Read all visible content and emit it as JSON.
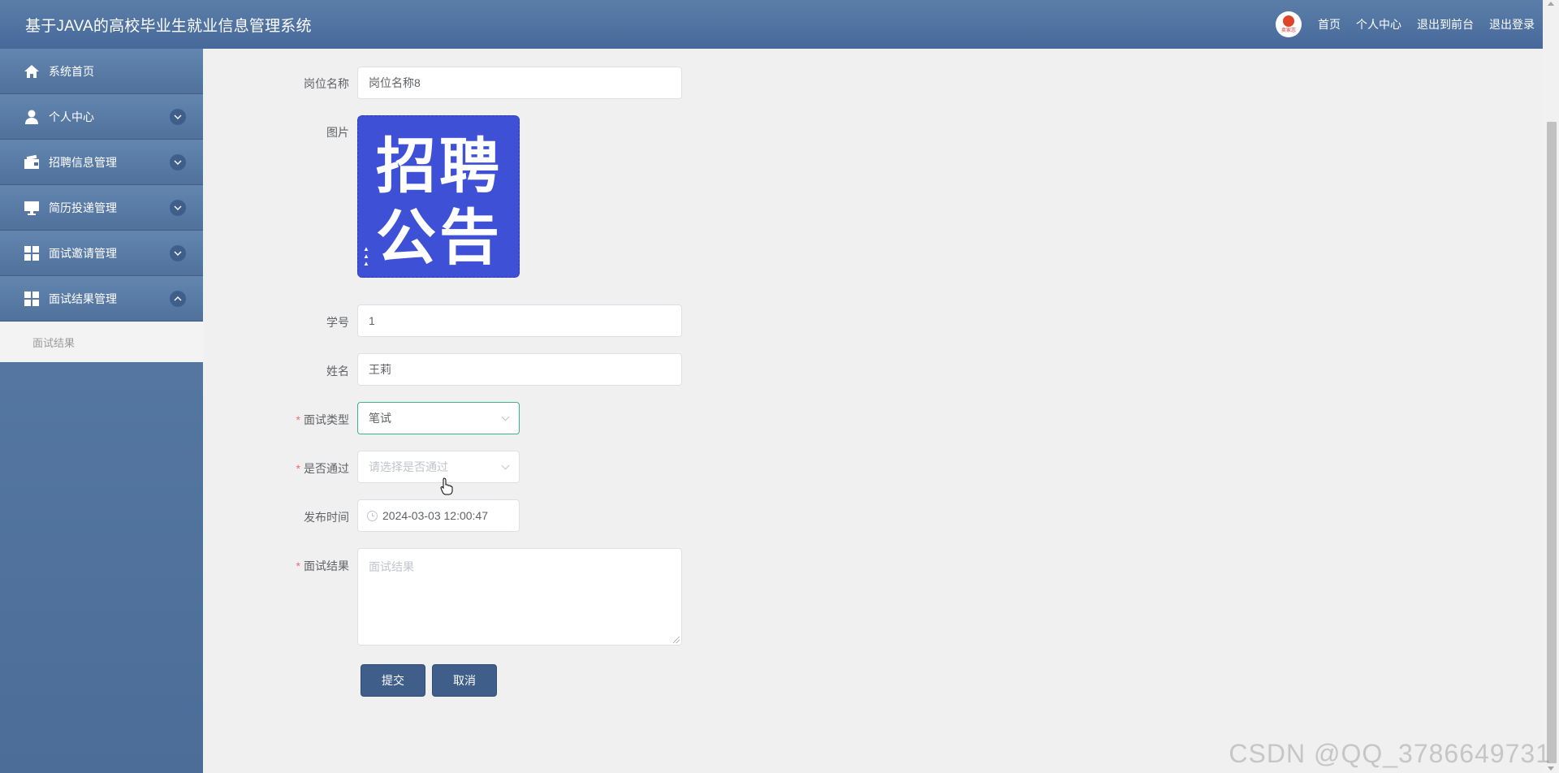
{
  "header": {
    "title": "基于JAVA的高校毕业生就业信息管理系统",
    "avatar_text": "卖家志",
    "nav": [
      "首页",
      "个人中心",
      "退出到前台",
      "退出登录"
    ]
  },
  "sidebar": {
    "items": [
      {
        "label": "系统首页",
        "icon": "home-icon"
      },
      {
        "label": "个人中心",
        "icon": "user-icon"
      },
      {
        "label": "招聘信息管理",
        "icon": "wallet-icon"
      },
      {
        "label": "简历投递管理",
        "icon": "monitor-icon"
      },
      {
        "label": "面试邀请管理",
        "icon": "grid-icon"
      },
      {
        "label": "面试结果管理",
        "icon": "grid-icon"
      }
    ],
    "submenu": {
      "label": "面试结果"
    }
  },
  "form": {
    "job_name": {
      "label": "岗位名称",
      "value": "岗位名称8"
    },
    "image": {
      "label": "图片",
      "poster_text_line1": "招聘",
      "poster_text_line2": "公告"
    },
    "student_id": {
      "label": "学号",
      "value": "1"
    },
    "name": {
      "label": "姓名",
      "value": "王莉"
    },
    "interview_type": {
      "label": "面试类型",
      "value": "笔试",
      "required": true
    },
    "passed": {
      "label": "是否通过",
      "placeholder": "请选择是否通过",
      "required": true
    },
    "publish_time": {
      "label": "发布时间",
      "value": "2024-03-03 12:00:47"
    },
    "result": {
      "label": "面试结果",
      "placeholder": "面试结果",
      "required": true
    },
    "submit_label": "提交",
    "cancel_label": "取消"
  },
  "watermark": "CSDN @QQ_3786649731",
  "colors": {
    "header_bg": "#5b7ea8",
    "button_bg": "#3f5f8a",
    "required": "#f56c6c",
    "focus_border": "#3cb38a",
    "poster_bg": "#3e51d6"
  }
}
